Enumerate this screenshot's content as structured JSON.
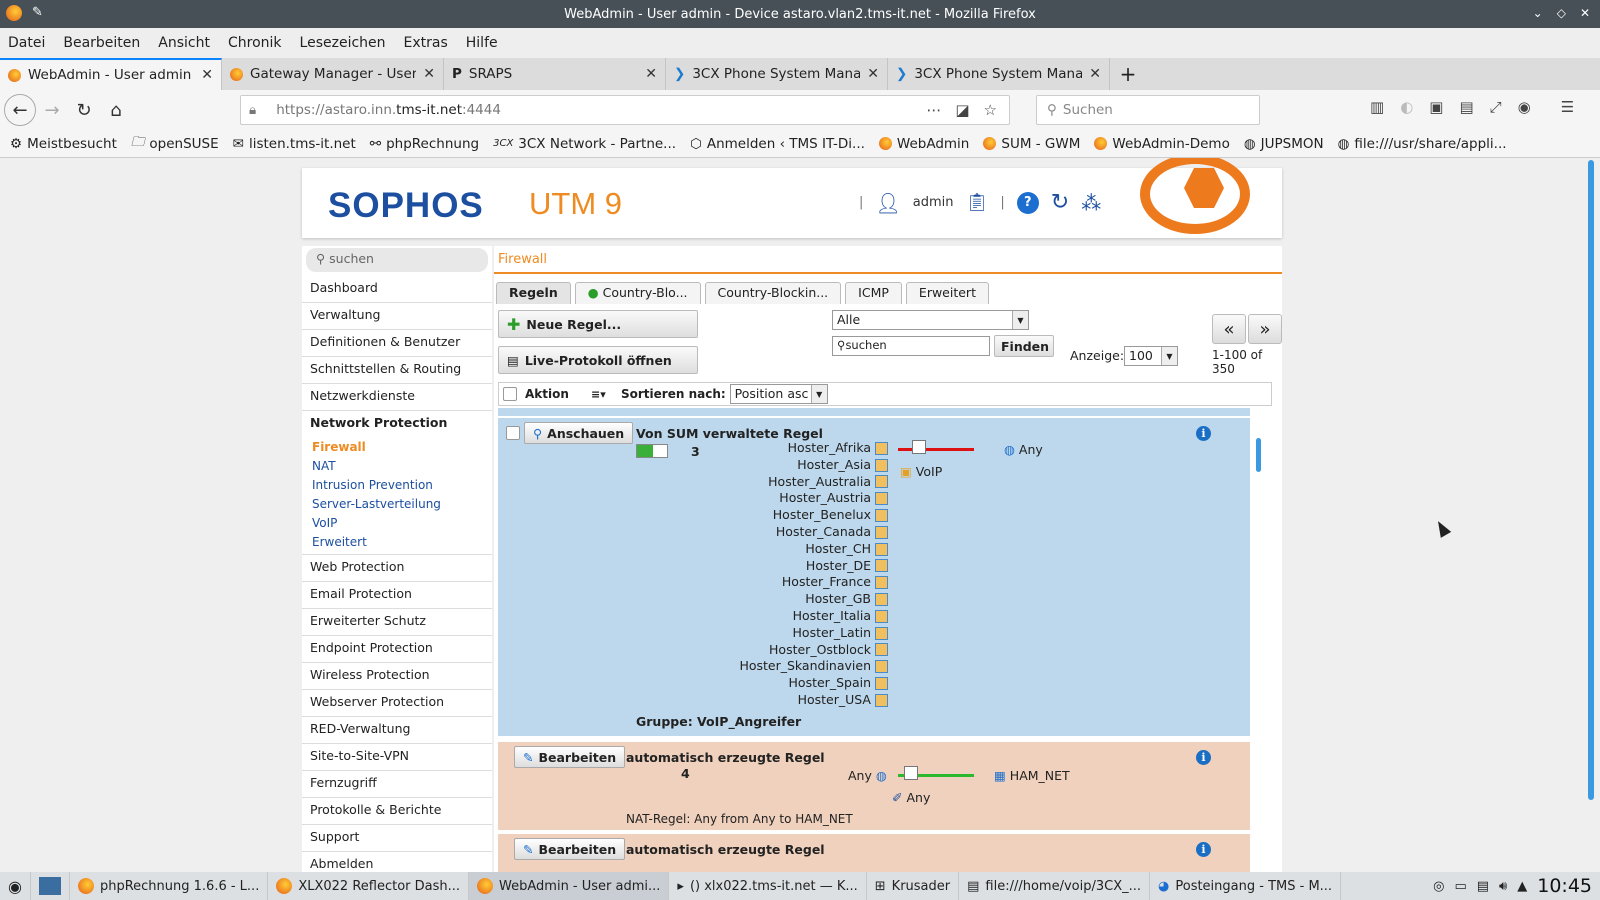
{
  "window": {
    "title": "WebAdmin - User admin - Device astaro.vlan2.tms-it.net - Mozilla Firefox"
  },
  "menu": [
    "Datei",
    "Bearbeiten",
    "Ansicht",
    "Chronik",
    "Lesezeichen",
    "Extras",
    "Hilfe"
  ],
  "tabs": [
    {
      "label": "WebAdmin - User admin - D"
    },
    {
      "label": "Gateway Manager - User: a"
    },
    {
      "label": "SRAPS"
    },
    {
      "label": "3CX Phone System Manag"
    },
    {
      "label": "3CX Phone System Manag"
    }
  ],
  "url": {
    "prefix": "https://astaro.inn.",
    "host": "tms-it.net",
    "suffix": ":4444"
  },
  "search": {
    "placeholder": "Suchen"
  },
  "bookmarks": [
    "Meistbesucht",
    "openSUSE",
    "listen.tms-it.net",
    "phpRechnung",
    "3CX Network - Partne...",
    "Anmelden ‹ TMS IT-Di...",
    "WebAdmin",
    "SUM - GWM",
    "WebAdmin-Demo",
    "JUPSMON",
    "file:///usr/share/appli..."
  ],
  "header": {
    "logo": "SOPHOS",
    "product": "UTM 9",
    "user": "admin"
  },
  "sidebar": {
    "search_placeholder": "suchen",
    "items_top": [
      "Dashboard",
      "Verwaltung",
      "Definitionen & Benutzer",
      "Schnittstellen & Routing",
      "Netzwerkdienste"
    ],
    "section": "Network Protection",
    "sub": [
      "Firewall",
      "NAT",
      "Intrusion Prevention",
      "Server-Lastverteilung",
      "VoIP",
      "Erweitert"
    ],
    "items_bottom": [
      "Web Protection",
      "Email Protection",
      "Erweiterter Schutz",
      "Endpoint Protection",
      "Wireless Protection",
      "Webserver Protection",
      "RED-Verwaltung",
      "Site-to-Site-VPN",
      "Fernzugriff",
      "Protokolle & Berichte",
      "Support",
      "Abmelden"
    ]
  },
  "main": {
    "breadcrumb": "Firewall",
    "tabs": [
      "Regeln",
      "Country-Blo...",
      "Country-Blockin...",
      "ICMP",
      "Erweitert"
    ],
    "new_rule": "Neue Regel...",
    "live_log": "Live-Protokoll öffnen",
    "filter_value": "Alle",
    "filter_search": "suchen",
    "find": "Finden",
    "display_label": "Anzeige:",
    "display_value": "100",
    "range": "1-100 of 350",
    "list_action": "Aktion",
    "sort_label": "Sortieren nach:",
    "sort_value": "Position asc"
  },
  "rules": [
    {
      "button": "Anschauen",
      "title": "Von SUM verwaltete Regel",
      "number": "3",
      "sources": [
        "Hoster_Afrika",
        "Hoster_Asia",
        "Hoster_Australia",
        "Hoster_Austria",
        "Hoster_Benelux",
        "Hoster_Canada",
        "Hoster_CH",
        "Hoster_DE",
        "Hoster_France",
        "Hoster_GB",
        "Hoster_Italia",
        "Hoster_Latin",
        "Hoster_Ostblock",
        "Hoster_Skandinavien",
        "Hoster_Spain",
        "Hoster_USA"
      ],
      "service": "VoIP",
      "dest": "Any",
      "group": "Gruppe: VoIP_Angreifer"
    },
    {
      "button": "Bearbeiten",
      "title": "automatisch erzeugte Regel",
      "number": "4",
      "source": "Any",
      "service": "Any",
      "dest": "HAM_NET",
      "note": "NAT-Regel: Any from Any to HAM_NET"
    },
    {
      "button": "Bearbeiten",
      "title": "automatisch erzeugte Regel"
    }
  ],
  "taskbar": [
    "phpRechnung 1.6.6 - L...",
    "XLX022 Reflector Dash...",
    "WebAdmin - User admi...",
    "() xlx022.tms-it.net — K...",
    "Krusader",
    "file:///home/voip/3CX_...",
    "Posteingang - TMS - M..."
  ],
  "clock": "10:45"
}
